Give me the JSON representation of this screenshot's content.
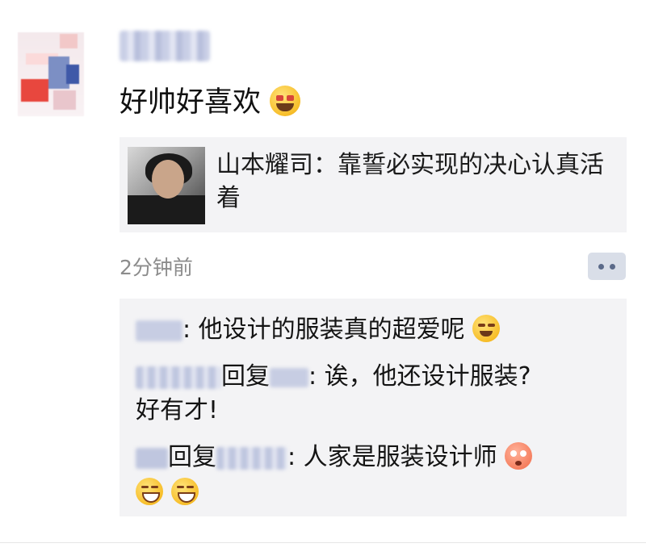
{
  "post": {
    "text": "好帅好喜欢",
    "emoji": "star-struck-emoji"
  },
  "share": {
    "title": "山本耀司：靠誓必实现的决心认真活着",
    "thumbnail": "portrait-photo"
  },
  "meta": {
    "time": "2分钟前",
    "comment_icon": "comment-bubble-icon"
  },
  "comments": [
    {
      "text": ": 他设计的服装真的超爱呢",
      "emoji": "smiling-emoji"
    },
    {
      "reply_label": "回复",
      "text": ": 诶，他还设计服装?",
      "text2": "好有才!"
    },
    {
      "reply_label": "回复",
      "text": ": 人家是服装设计师",
      "emoji": "flushed-emoji",
      "emoji2": "grinning-squint-emoji"
    }
  ],
  "colors": {
    "card_bg": "#f3f3f5",
    "time_text": "#8c8c8c",
    "comment_button": "#d9dee8"
  }
}
